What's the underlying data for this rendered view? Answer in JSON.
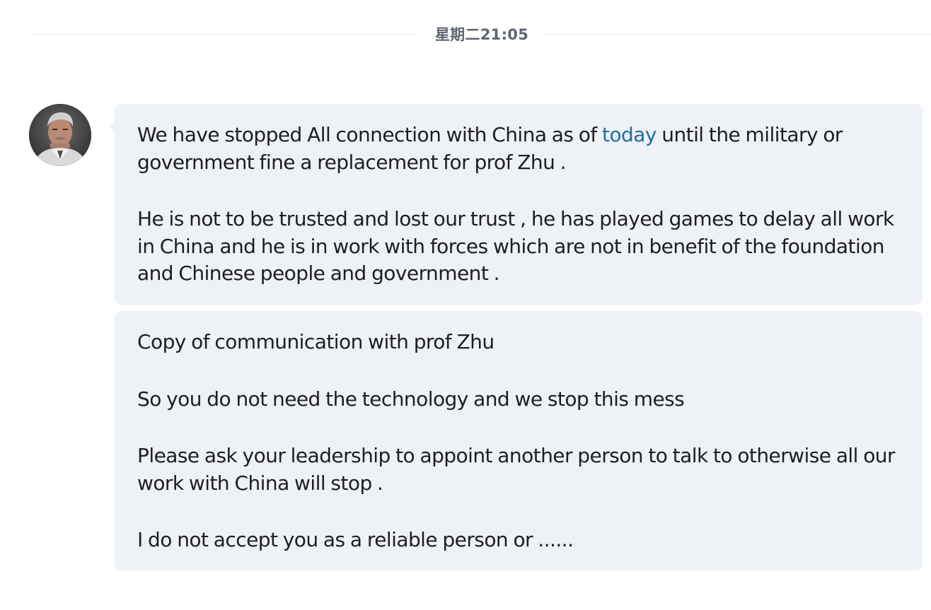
{
  "timestamp": "星期二21:05",
  "messages": [
    {
      "sender": "contact",
      "paragraphs": [
        {
          "before": "We have stopped All connection with China as of ",
          "link": "today",
          "after": " until the military or government fine a replacement for prof Zhu ."
        },
        {
          "text": "He is not to be trusted and lost our trust , he has played games to delay all work in China and he is in work with forces which are not in benefit of the foundation and Chinese people and government ."
        }
      ]
    },
    {
      "sender": "contact",
      "paragraphs": [
        {
          "text": "Copy of communication with prof Zhu"
        },
        {
          "text": "So you do not need the technology and we stop this mess"
        },
        {
          "text": "Please ask your leadership to appoint another person to talk to otherwise all our work with China will stop ."
        },
        {
          "text": "I do not accept you as a reliable person or ......"
        }
      ]
    }
  ],
  "colors": {
    "bubble_bg": "#eef1f6",
    "link": "#1f6fa0",
    "timestamp": "#5e6670"
  }
}
